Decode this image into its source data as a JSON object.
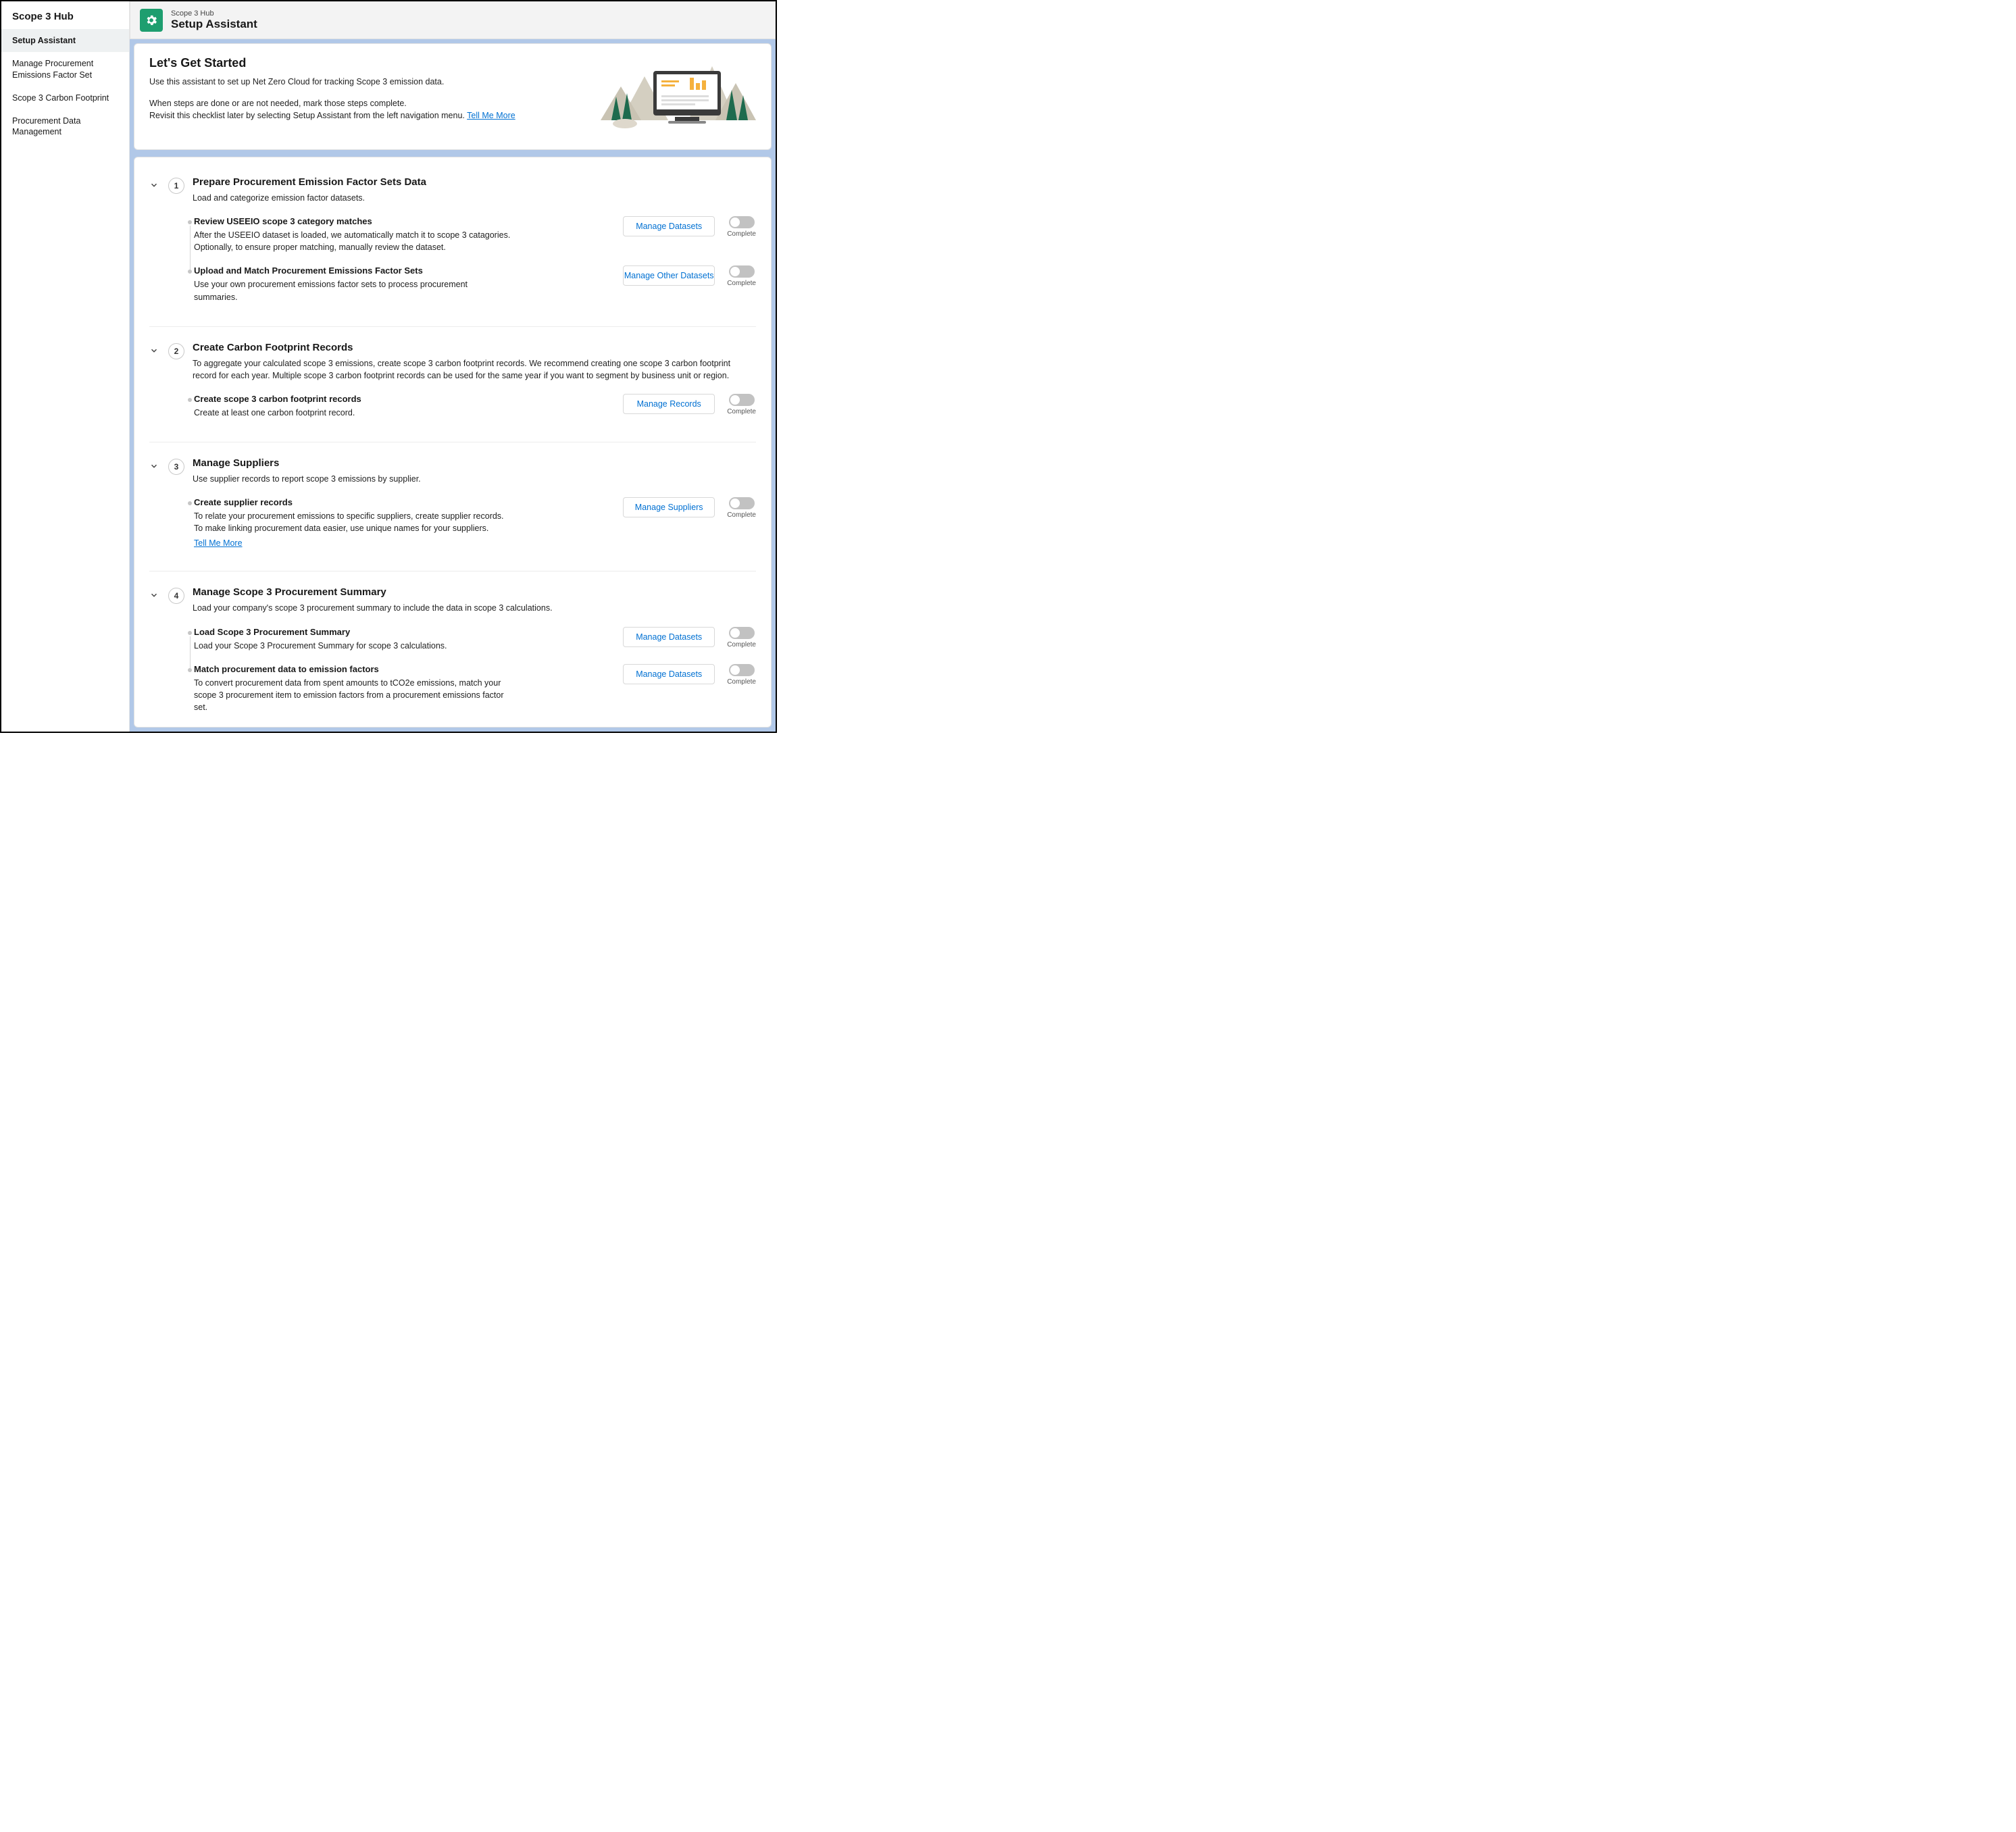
{
  "sidebar": {
    "title": "Scope 3 Hub",
    "items": [
      {
        "label": "Setup Assistant",
        "active": true
      },
      {
        "label": "Manage Procurement Emissions Factor Set",
        "active": false
      },
      {
        "label": "Scope 3 Carbon Footprint",
        "active": false
      },
      {
        "label": "Procurement Data Management",
        "active": false
      }
    ]
  },
  "header": {
    "crumb": "Scope 3 Hub",
    "title": "Setup Assistant"
  },
  "intro": {
    "heading": "Let's Get Started",
    "line1": "Use this assistant to set up Net Zero Cloud for tracking Scope 3 emission data.",
    "line2a": "When steps are done or are not needed, mark those steps complete.",
    "line2b": "Revisit this checklist later by selecting Setup Assistant from the left navigation menu. ",
    "tell_me_more": "Tell Me More"
  },
  "toggle_label": "Complete",
  "sections": [
    {
      "num": "1",
      "title": "Prepare Procurement Emission Factor Sets Data",
      "desc": "Load and categorize emission factor datasets.",
      "steps": [
        {
          "title": "Review USEEIO scope 3 category matches",
          "desc": "After the USEEIO dataset is loaded, we automatically match it to scope 3 catagories. Optionally, to ensure proper matching, manually review the dataset.",
          "button": "Manage Datasets",
          "tell_me_more": false
        },
        {
          "title": "Upload and Match Procurement Emissions Factor Sets",
          "desc": "Use your own procurement emissions factor sets to process procurement summaries.",
          "button": "Manage Other Datasets",
          "tell_me_more": false
        }
      ]
    },
    {
      "num": "2",
      "title": "Create Carbon Footprint Records",
      "desc": "To aggregate your calculated scope 3 emissions, create scope 3 carbon footprint records. We recommend creating one scope 3 carbon footprint record for each year. Multiple scope 3 carbon footprint records can be used for the same year if you want to segment by business unit or region.",
      "steps": [
        {
          "title": "Create scope 3 carbon footprint records",
          "desc": "Create at least one carbon footprint record.",
          "button": "Manage Records",
          "tell_me_more": false
        }
      ]
    },
    {
      "num": "3",
      "title": "Manage Suppliers",
      "desc": "Use supplier records to report scope 3 emissions by supplier.",
      "steps": [
        {
          "title": "Create supplier records",
          "desc": "To relate your procurement emissions to specific suppliers, create supplier records. To make linking procurement data easier, use unique names for your suppliers.",
          "button": "Manage Suppliers",
          "tell_me_more": true
        }
      ]
    },
    {
      "num": "4",
      "title": "Manage Scope 3 Procurement Summary",
      "desc": "Load your company's scope 3 procurement summary to include the data in scope 3 calculations.",
      "steps": [
        {
          "title": "Load Scope 3 Procurement Summary",
          "desc": "Load your Scope 3 Procurement Summary for scope 3 calculations.",
          "button": "Manage Datasets",
          "tell_me_more": false
        },
        {
          "title": "Match procurement data to emission factors",
          "desc": "To convert procurement data from spent amounts to tCO2e emissions, match your scope 3 procurement item to emission factors from a procurement emissions factor set.",
          "button": "Manage Datasets",
          "tell_me_more": false
        }
      ]
    }
  ],
  "tell_me_more_label": "Tell Me More",
  "colors": {
    "accent": "#0070d2",
    "icon_bg": "#1e9e6f",
    "page_bg": "#b1c8e8"
  }
}
